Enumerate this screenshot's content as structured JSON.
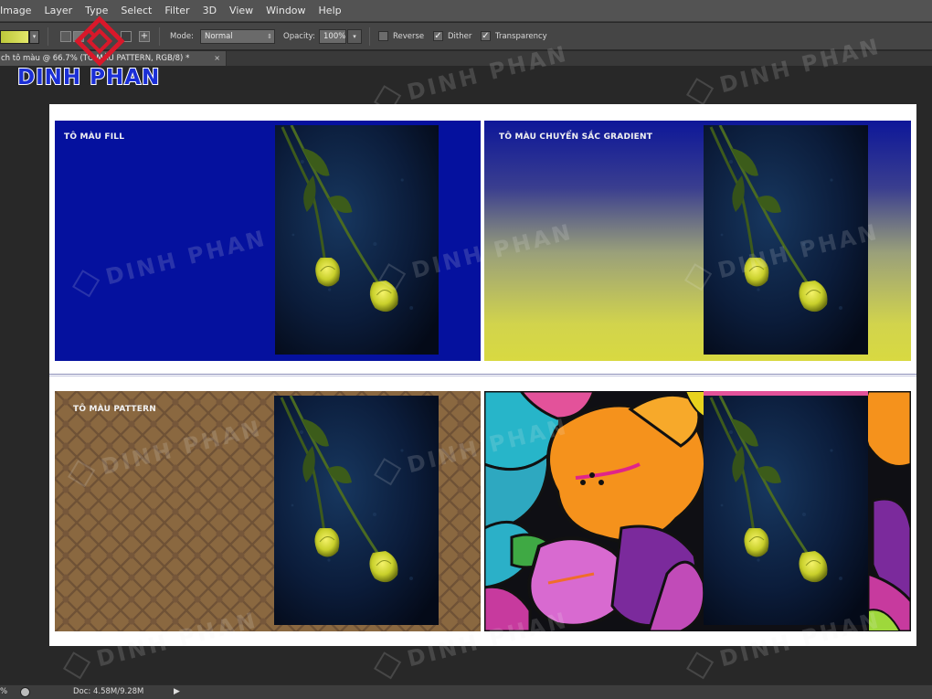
{
  "menu": [
    "Image",
    "Layer",
    "Type",
    "Select",
    "Filter",
    "3D",
    "View",
    "Window",
    "Help"
  ],
  "options": {
    "mode_label": "Mode:",
    "mode_value": "Normal",
    "opacity_label": "Opacity:",
    "opacity_value": "100%",
    "reverse_label": "Reverse",
    "dither_label": "Dither",
    "transparency_label": "Transparency",
    "reverse_checked": false,
    "dither_checked": true,
    "transparency_checked": true
  },
  "document_tab": {
    "title": "ch tô màu @ 66.7% (TÔ MÀU PATTERN, RGB/8) *",
    "close": "×"
  },
  "logo": {
    "text": "DINH PHAN",
    "brand_color": "#1b2fd6",
    "mark_color": "#d8182a"
  },
  "watermark_text": "DINH PHAN",
  "panels": {
    "fill": {
      "label": "TÔ MÀU FILL",
      "color": "#05119e"
    },
    "gradient": {
      "label": "TÔ MÀU CHUYỂN SẮC GRADIENT",
      "colors": [
        "#0d1799",
        "#d8d941"
      ]
    },
    "pattern": {
      "label": "TÔ MÀU PATTERN",
      "color": "#8a6840"
    },
    "flower": {
      "label": ""
    }
  },
  "status": {
    "zoom": "%",
    "doc": "Doc: 4.58M/9.28M"
  }
}
